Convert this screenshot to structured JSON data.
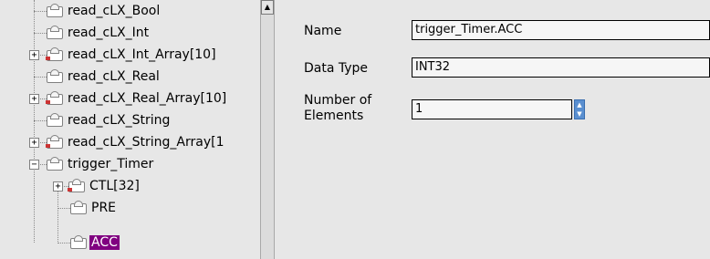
{
  "tree": {
    "items": [
      {
        "label": "read_cLX_Bool",
        "expander": "",
        "selected": false
      },
      {
        "label": "read_cLX_Int",
        "expander": "",
        "selected": false
      },
      {
        "label": "read_cLX_Int_Array[10]",
        "expander": "+",
        "selected": false
      },
      {
        "label": "read_cLX_Real",
        "expander": "",
        "selected": false
      },
      {
        "label": "read_cLX_Real_Array[10]",
        "expander": "+",
        "selected": false
      },
      {
        "label": "read_cLX_String",
        "expander": "",
        "selected": false
      },
      {
        "label": "read_cLX_String_Array[1",
        "expander": "+",
        "selected": false
      },
      {
        "label": "trigger_Timer",
        "expander": "−",
        "selected": false
      },
      {
        "label": "CTL[32]",
        "expander": "+",
        "selected": false
      },
      {
        "label": "PRE",
        "expander": "",
        "selected": false
      },
      {
        "label": "ACC",
        "expander": "",
        "selected": true
      }
    ],
    "selected_color": "#800080"
  },
  "properties": {
    "name_label": "Name",
    "name_value": "trigger_Timer.ACC",
    "datatype_label": "Data Type",
    "datatype_value": "INT32",
    "elements_label_line1": "Number of",
    "elements_label_line2": "Elements",
    "elements_value": "1"
  },
  "icons": {
    "scroll_up": "scroll-up-arrow-icon",
    "node": "tag-node-icon",
    "spinner": "spinner-icon"
  }
}
